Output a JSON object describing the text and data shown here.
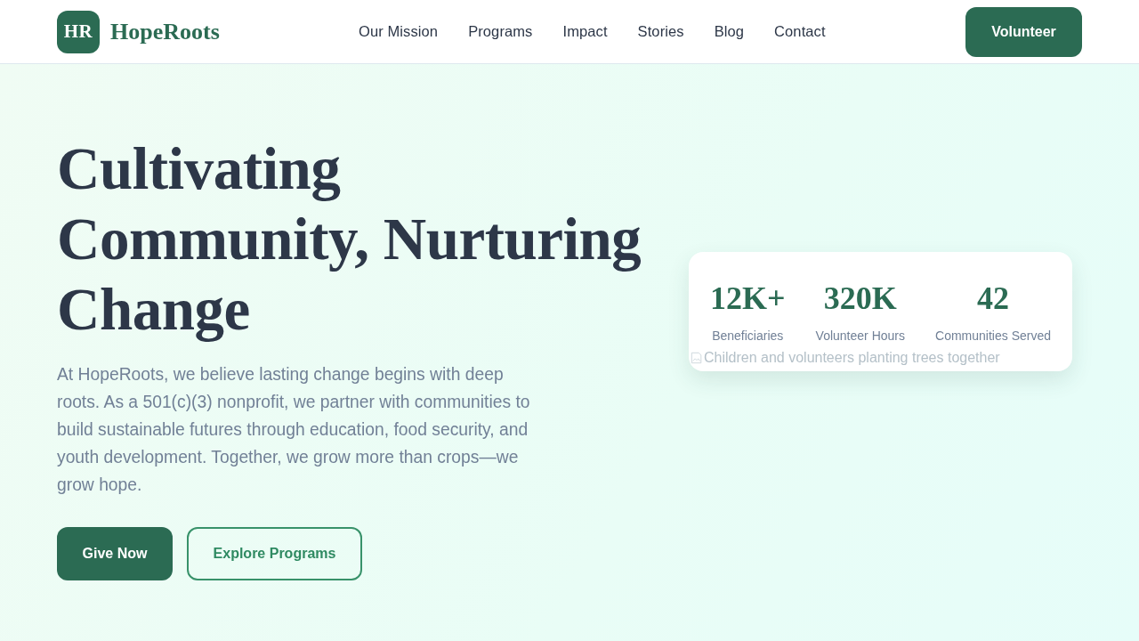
{
  "header": {
    "logo": {
      "monogram": "HR",
      "name": "HopeRoots"
    },
    "nav": [
      "Our Mission",
      "Programs",
      "Impact",
      "Stories",
      "Blog",
      "Contact"
    ],
    "cta": "Volunteer"
  },
  "hero": {
    "headline": "Cultivating Community, Nurturing Change",
    "description": "At HopeRoots, we believe lasting change begins with deep roots. As a 501(c)(3) nonprofit, we partner with communities to build sustainable futures through education, food security, and youth development. Together, we grow more than crops—we grow hope.",
    "buttons": [
      {
        "label": "Give Now",
        "kind": "primary"
      },
      {
        "label": "Explore Programs",
        "kind": "outline"
      }
    ],
    "stats_card": {
      "stats": [
        {
          "value": "12K+",
          "label": "Beneficiaries"
        },
        {
          "value": "320K",
          "label": "Volunteer Hours"
        },
        {
          "value": "42",
          "label": "Communities Served"
        }
      ],
      "image_alt": "Children and volunteers planting trees together"
    }
  }
}
